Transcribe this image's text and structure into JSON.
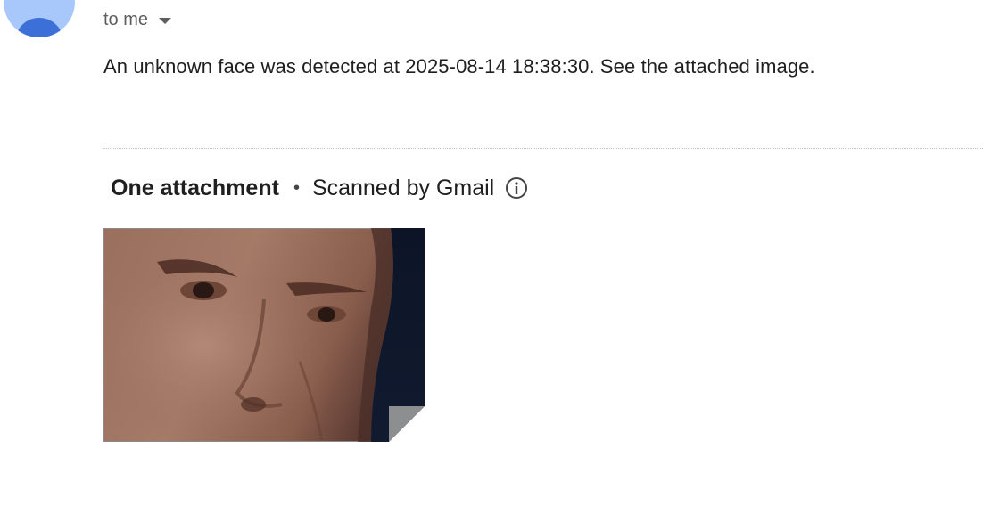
{
  "recipient": {
    "label": "to me"
  },
  "message": {
    "text": "An unknown face was detected at 2025-08-14 18:38:30. See the attached image."
  },
  "attachments": {
    "count_label": "One attachment",
    "separator": "•",
    "scan_label": "Scanned by Gmail",
    "thumbnail": {
      "kind": "photo",
      "subject": "close-up face"
    }
  },
  "colors": {
    "avatar_bg": "#a8c7fa",
    "avatar_fg": "#3c6fd8",
    "secondary_text": "#5e5e5e",
    "primary_text": "#1f1f1f"
  }
}
